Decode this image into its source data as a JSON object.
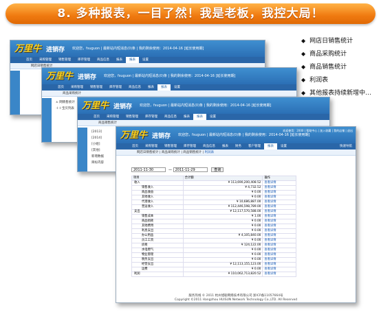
{
  "banner": {
    "text": "8. 多种报表，一目了然！我是老板，我控大局！"
  },
  "features": [
    "网店日销售统计",
    "商品采购统计",
    "商品销售统计",
    "利润表",
    "其他报表持续新增中…"
  ],
  "app": {
    "logo": "万里牛",
    "logo_sub": "进销存",
    "welcome": "欢迎您，fsuguon | 最新站内短消息(0)条 | 我的剩余使用：2014-04-16 [延长使用期]",
    "top_links": "欢迎使用：2000 | 帮助中心 | 加入收藏 | 我的店铺 | 退出",
    "quick": "快速导航"
  },
  "nav": [
    "首页",
    "采购管理",
    "销售管理",
    "库存管理",
    "商品信息",
    "报表",
    "财务",
    "客户管理",
    "报表",
    "设置"
  ],
  "sub_tabs": [
    "网店日销售统计",
    "商品采购统计",
    "商品销售统计",
    "利润表"
  ],
  "side": {
    "label": "通知公告"
  },
  "tree": [
    "± 网销售统计",
    "＋＋宝贝列表",
    "[2013]",
    "[2014]",
    "[小组]",
    "[其他]",
    "新增数据",
    "目标内容",
    "数据分析",
    "[各地区]"
  ],
  "query": {
    "from": "2011-11-30",
    "to": "2011-11-29",
    "button": "查询"
  },
  "table": {
    "headers": [
      "项目",
      "合计额",
      "操作"
    ],
    "rows": [
      [
        "收入",
        "¥ 113,690,200,408.52",
        "查看详情"
      ],
      [
        "销售收入",
        "¥ 4,732.52",
        "查看详情"
      ],
      [
        "商品收益",
        "¥ 0.00",
        "查看详情"
      ],
      [
        "其他收入",
        "¥ 0.00",
        "查看详情"
      ],
      [
        "代理收入",
        "¥ 10,686,887.00",
        "查看详情"
      ],
      [
        "营运收入",
        "¥ 112,446,598,789.00",
        "查看详情"
      ],
      [
        "支出",
        "¥ 12,117,570,588.00",
        "查看详情"
      ],
      [
        "销售成本",
        "¥ 1.00",
        "查看详情"
      ],
      [
        "商品损耗",
        "¥ 0.00",
        "查看详情"
      ],
      [
        "其他费用",
        "¥ 0.00",
        "查看详情"
      ],
      [
        "利息支出",
        "¥ 0.00",
        "查看详情"
      ],
      [
        "办公用品",
        "¥ 4,105,840.00",
        "查看详情"
      ],
      [
        "员工工资",
        "¥ 0.00",
        "查看详情"
      ],
      [
        "房租",
        "¥ 124,122.00",
        "查看详情"
      ],
      [
        "水电燃气",
        "¥ 0.00",
        "查看详情"
      ],
      [
        "物业管理",
        "¥ 0.00",
        "查看详情"
      ],
      [
        "税务支出",
        "¥ 0.00",
        "查看详情"
      ],
      [
        "经营支出",
        "¥ 12,113,155,123.00",
        "查看详情"
      ],
      [
        "运费",
        "¥ 0.00",
        "查看详情"
      ],
      [
        "利润",
        "¥ 110,062,713,820.52",
        "查看详情"
      ]
    ]
  },
  "footer": [
    "服务热线 © 2011 杭州旭聪网络技术有限公司 浙ICP备11057664号",
    "Copyright ©2011 Hangzhou HUISUN Network Technology Co.,LTD. All Reserved"
  ]
}
